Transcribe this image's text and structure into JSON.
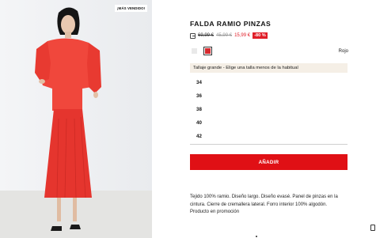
{
  "product": {
    "bestseller_badge": "¡MÁS VENDIDO!",
    "title": "FALDA RAMIO PINZAS",
    "price_icon": "price-history-icon",
    "price_old_1": "69,99 €",
    "price_old_2": "45,99 €",
    "price_new": "15,99 €",
    "discount": "-80 %",
    "color_selected": "Rojo",
    "colors": [
      {
        "name": "grey",
        "hex": "#e9e9e9"
      },
      {
        "name": "red",
        "hex": "#d62a2f"
      }
    ],
    "size_hint": "Tallaje grande - Elige una talla menos de la habitual",
    "sizes": [
      "34",
      "36",
      "38",
      "40",
      "42"
    ],
    "add_button": "AÑADIR",
    "description_lines": [
      "Tejido 100% ramio. Diseño largo. Diseño evasé. Panel de pinzas en la",
      "cintura. Cierre de cremallera lateral. Forro interior 100% algodón.",
      "Producto en promoción"
    ]
  },
  "colors": {
    "accent": "#e01015",
    "sale_red": "#e01e28",
    "hint_bg": "#f5efe6"
  }
}
